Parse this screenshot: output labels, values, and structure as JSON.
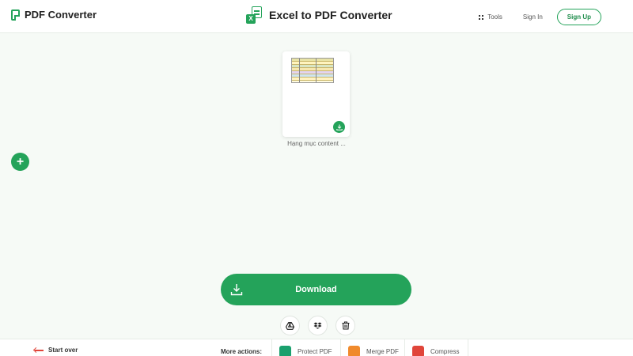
{
  "header": {
    "brand": "PDF Converter",
    "title": "Excel to PDF Converter",
    "tools_label": "Tools",
    "signin_label": "Sign In",
    "signup_label": "Sign Up"
  },
  "file": {
    "name": "Hạng mục content ..."
  },
  "download": {
    "label": "Download"
  },
  "footer": {
    "start_over": "Start over",
    "more_actions": "More actions:",
    "items": [
      {
        "label": "Protect PDF",
        "icon": "lock-icon",
        "color": "#1aa06d"
      },
      {
        "label": "Merge PDF",
        "icon": "merge-icon",
        "color": "#f08a2c"
      },
      {
        "label": "Compress",
        "icon": "compress-icon",
        "color": "#e0453a"
      }
    ]
  },
  "colors": {
    "accent": "#24a35a",
    "danger": "#e0453a"
  }
}
